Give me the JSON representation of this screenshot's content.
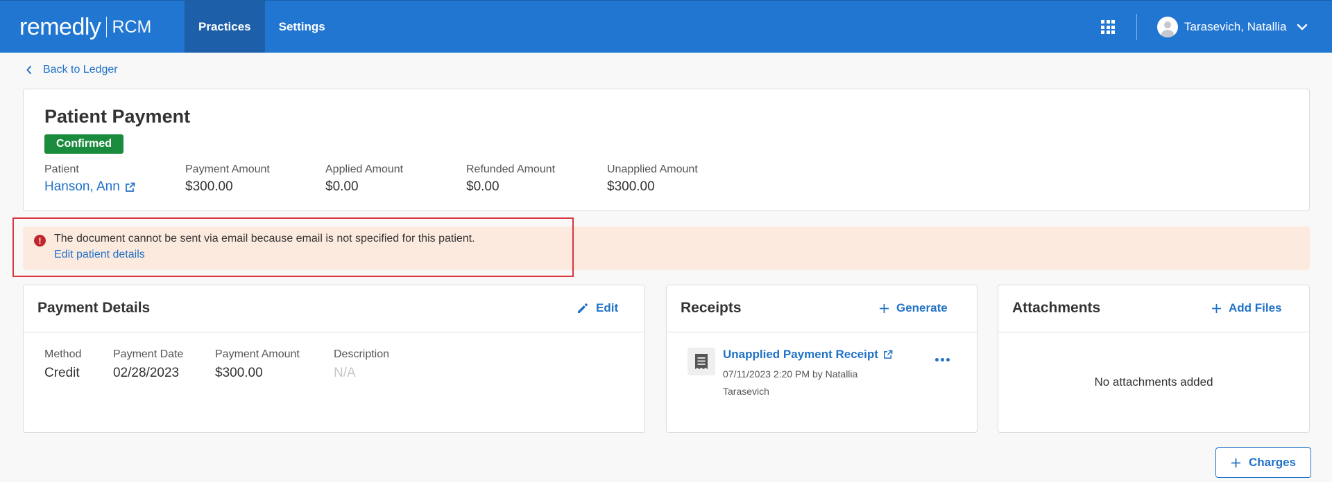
{
  "header": {
    "logo_main": "remedly",
    "logo_sub": "RCM",
    "nav": [
      {
        "label": "Practices",
        "active": true
      },
      {
        "label": "Settings",
        "active": false
      }
    ],
    "apps_icon": "grid-icon",
    "user_name": "Tarasevich, Natallia",
    "brand_color": "#2176d2"
  },
  "back_link": "Back to Ledger",
  "payment": {
    "title": "Patient Payment",
    "status": "Confirmed",
    "status_color": "#1a8a3d",
    "fields": [
      {
        "label": "Patient",
        "value": "Hanson, Ann"
      },
      {
        "label": "Payment Amount",
        "value": "$300.00"
      },
      {
        "label": "Applied Amount",
        "value": "$0.00"
      },
      {
        "label": "Refunded Amount",
        "value": "$0.00"
      },
      {
        "label": "Unapplied Amount",
        "value": "$300.00"
      }
    ]
  },
  "alert": {
    "message": "The document cannot be sent via email because email is not specified for this patient.",
    "link": "Edit patient details"
  },
  "details": {
    "title": "Payment Details",
    "action": "Edit",
    "fields": [
      {
        "label": "Method",
        "value": "Credit"
      },
      {
        "label": "Payment Date",
        "value": "02/28/2023"
      },
      {
        "label": "Payment Amount",
        "value": "$300.00"
      },
      {
        "label": "Description",
        "value": "N/A"
      }
    ]
  },
  "receipts": {
    "title": "Receipts",
    "action": "Generate",
    "item_name": "Unapplied Payment Receipt",
    "item_meta": "07/11/2023 2:20 PM by Natallia Tarasevich"
  },
  "attachments": {
    "title": "Attachments",
    "action": "Add Files",
    "empty": "No attachments added"
  },
  "charges_button": "Charges"
}
